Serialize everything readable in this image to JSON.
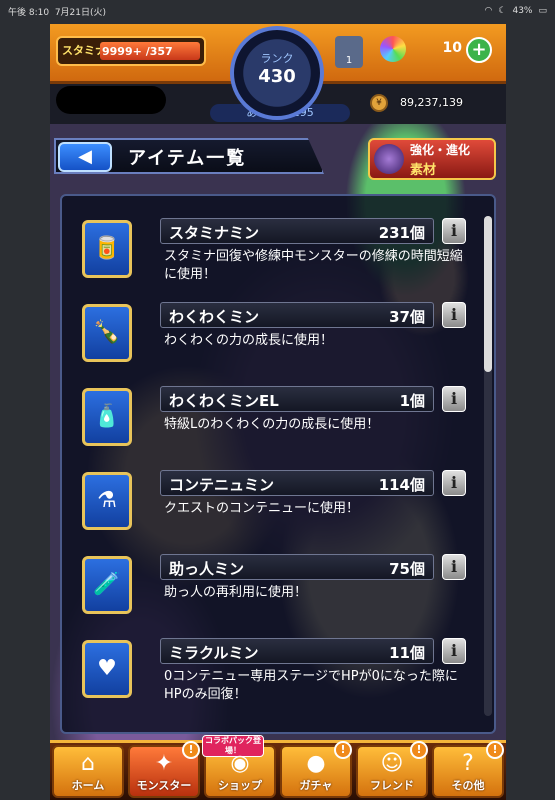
{
  "status_bar": {
    "time": "午後 8:10",
    "date": "7月21日(火)",
    "battery": "43%"
  },
  "top": {
    "stamina_label": "スタミナ",
    "stamina_value": "9999+",
    "stamina_max": "/357",
    "rank_label": "ランク",
    "rank_value": "430",
    "next_rank": "あと 231295",
    "item_box_count": "1",
    "orb_count": "10",
    "plus": "+",
    "coins": "89,237,139"
  },
  "header": {
    "back": "◀",
    "title": "アイテム一覧",
    "evo_line1": "強化・進化",
    "evo_line2": "素材"
  },
  "items": [
    {
      "name": "スタミナミン",
      "qty": "231個",
      "desc": "スタミナ回復や修練中モンスターの修練の時間短縮に使用！",
      "icon": "can-icon"
    },
    {
      "name": "わくわくミン",
      "qty": "37個",
      "desc": "わくわくの力の成長に使用！",
      "icon": "bottle-icon"
    },
    {
      "name": "わくわくミンEL",
      "qty": "1個",
      "desc": "特級Lのわくわくの力の成長に使用！",
      "icon": "bottle-el-icon"
    },
    {
      "name": "コンテニュミン",
      "qty": "114個",
      "desc": "クエストのコンテニューに使用！",
      "icon": "flask-icon"
    },
    {
      "name": "助っ人ミン",
      "qty": "75個",
      "desc": "助っ人の再利用に使用！",
      "icon": "vial-icon"
    },
    {
      "name": "ミラクルミン",
      "qty": "11個",
      "desc": "0コンテニュー専用ステージでHPが0になった際にHPのみ回復！",
      "icon": "heart-potion-icon"
    }
  ],
  "tabs": [
    {
      "label": "ホーム",
      "icon": "home-icon",
      "badge": ""
    },
    {
      "label": "モンスター",
      "icon": "monster-icon",
      "badge": "!"
    },
    {
      "label": "ショップ",
      "icon": "shop-icon",
      "badge": "",
      "collab": "コラボパック登場！"
    },
    {
      "label": "ガチャ",
      "icon": "gacha-icon",
      "badge": "!"
    },
    {
      "label": "フレンド",
      "icon": "friend-icon",
      "badge": "!"
    },
    {
      "label": "その他",
      "icon": "other-icon",
      "badge": "!"
    }
  ]
}
